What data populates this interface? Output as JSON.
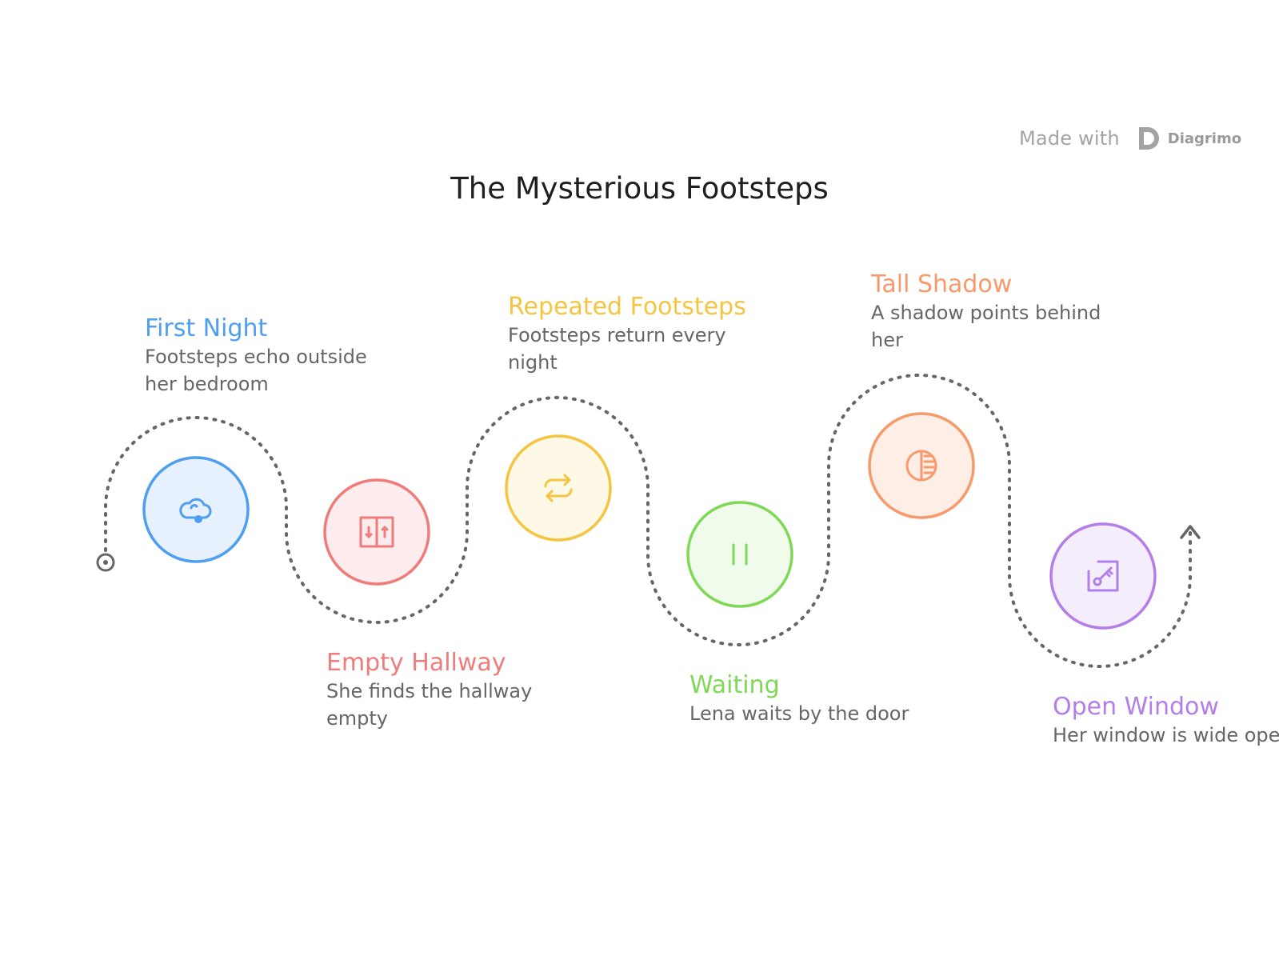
{
  "title": "The Mysterious Footsteps",
  "watermark": {
    "made_with": "Made with",
    "brand": "Diagrimo"
  },
  "steps": [
    {
      "title": "First Night",
      "description": "Footsteps echo outside her bedroom",
      "color": "#4f9ef0",
      "fill": "#e6f1fd",
      "icon": "cloud-icon"
    },
    {
      "title": "Empty Hallway",
      "description": "She finds the hallway empty",
      "color": "#f07b7b",
      "fill": "#fdeced",
      "icon": "elevator-icon"
    },
    {
      "title": "Repeated Footsteps",
      "description": "Footsteps return every night",
      "color": "#f5c542",
      "fill": "#fef9e6",
      "icon": "repeat-icon"
    },
    {
      "title": "Waiting",
      "description": "Lena waits by the door",
      "color": "#7ed957",
      "fill": "#f1fbec",
      "icon": "pause-icon"
    },
    {
      "title": "Tall Shadow",
      "description": "A shadow points behind her",
      "color": "#f79a6b",
      "fill": "#feeee5",
      "icon": "contrast-icon"
    },
    {
      "title": "Open Window",
      "description": "Her window is wide open",
      "color": "#b37ee8",
      "fill": "#f4edfc",
      "icon": "key-window-icon"
    }
  ]
}
